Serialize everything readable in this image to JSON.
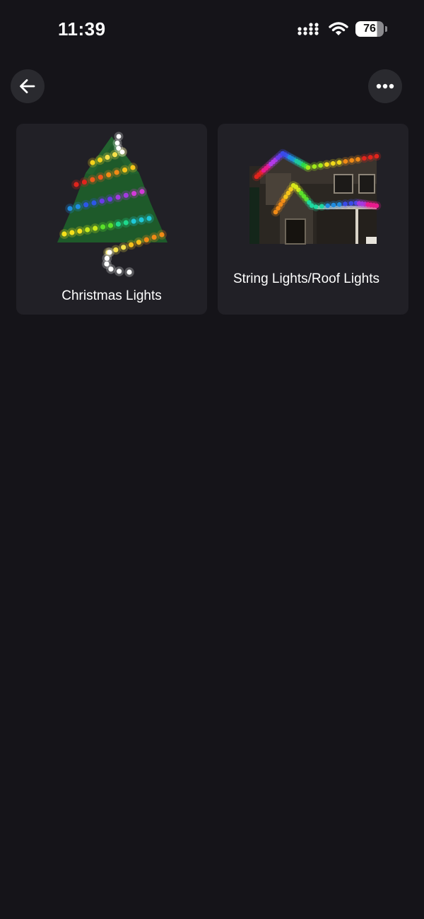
{
  "status_bar": {
    "time": "11:39",
    "battery_level": "76",
    "icons": [
      "signal-icon",
      "wifi-icon",
      "battery-icon"
    ]
  },
  "header": {
    "back_icon": "arrow-left-icon",
    "more_icon": "more-horizontal-icon"
  },
  "cards": [
    {
      "label": "Christmas Lights",
      "image": "christmas-tree-lights-image"
    },
    {
      "label": "String Lights/Roof Lights",
      "image": "house-roof-lights-image"
    }
  ],
  "colors": {
    "background": "#151419",
    "card": "#212026",
    "button": "#2a2a2f",
    "text": "#ffffff"
  }
}
